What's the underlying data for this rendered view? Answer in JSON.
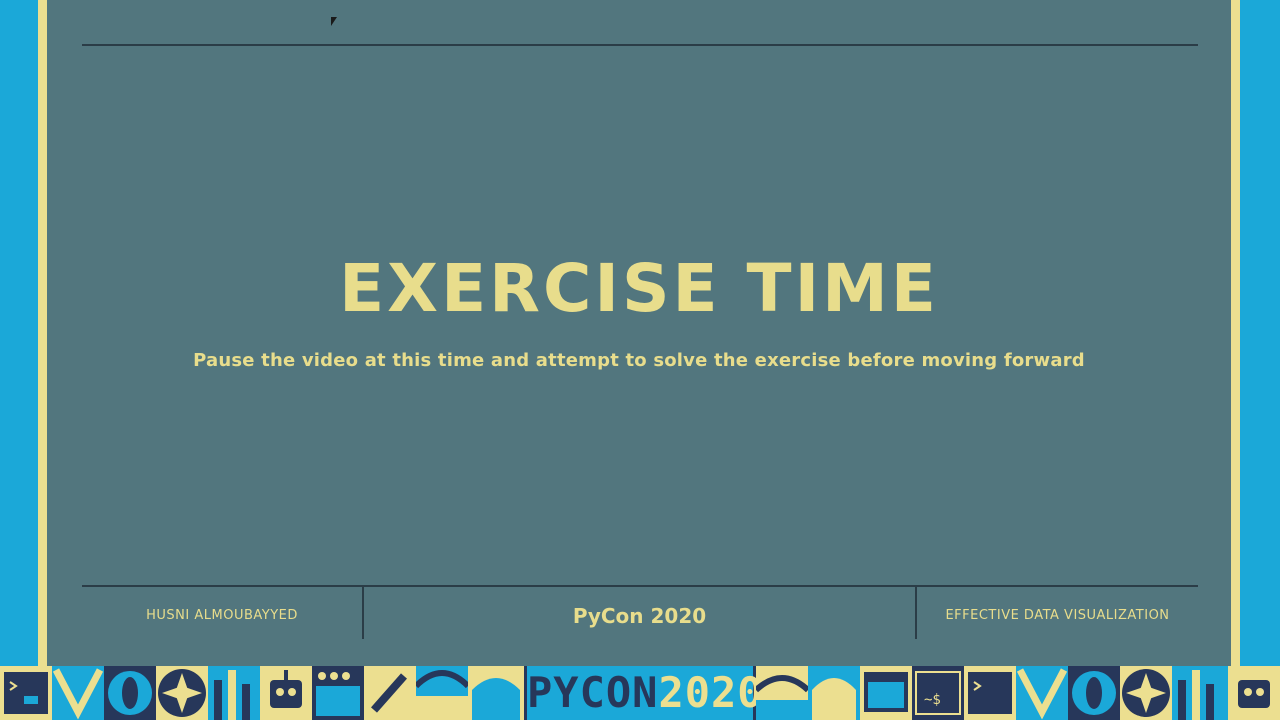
{
  "slide": {
    "title": "EXERCISE TIME",
    "subtitle": "Pause the video at this time and attempt to solve the exercise before moving forward"
  },
  "footer": {
    "presenter": "HUSNI ALMOUBAYYED",
    "event": "PyCon 2020",
    "talk": "EFFECTIVE DATA VISUALIZATION"
  },
  "banner": {
    "logo_word": "PYCON",
    "logo_year": "2020"
  },
  "colors": {
    "slide_background": "#52767e",
    "accent_text": "#e8dd8c",
    "frame_blue": "#1ba8d8",
    "frame_yellow": "#ecdf90",
    "navy": "#27375a"
  }
}
